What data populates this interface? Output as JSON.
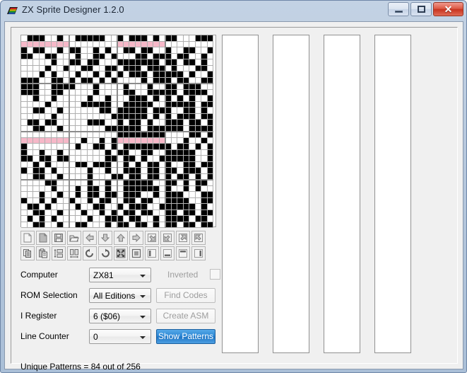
{
  "window": {
    "title": "ZX Sprite Designer 1.2.0",
    "icon": "zx-rainbow-icon",
    "controls": {
      "minimize": "minimize-icon",
      "maximize": "maximize-icon",
      "close": "✕"
    }
  },
  "toolbar": {
    "row1": [
      {
        "name": "new-file",
        "icon": "page-blank-icon"
      },
      {
        "name": "copy-page",
        "icon": "page-filled-icon"
      },
      {
        "name": "save-file",
        "icon": "floppy-disk-icon"
      },
      {
        "name": "open-file",
        "icon": "open-folder-icon"
      },
      {
        "name": "shift-left",
        "icon": "arrow-left-icon"
      },
      {
        "name": "shift-down",
        "icon": "arrow-down-icon"
      },
      {
        "name": "shift-up",
        "icon": "arrow-up-icon"
      },
      {
        "name": "shift-right",
        "icon": "arrow-right-icon"
      },
      {
        "name": "shift-down-right",
        "icon": "arrow-down-right-icon"
      },
      {
        "name": "shift-down-left",
        "icon": "arrow-down-left-icon"
      },
      {
        "name": "shift-up-right",
        "icon": "arrow-up-right-icon"
      },
      {
        "name": "shift-up-left",
        "icon": "arrow-up-left-icon"
      }
    ],
    "row2": [
      {
        "name": "copy",
        "icon": "copy-icon"
      },
      {
        "name": "paste",
        "icon": "clipboard-paste-icon"
      },
      {
        "name": "flip-vertical",
        "icon": "flip-vertical-icon"
      },
      {
        "name": "flip-horizontal",
        "icon": "flip-horizontal-icon"
      },
      {
        "name": "rotate-left",
        "icon": "rotate-ccw-icon"
      },
      {
        "name": "rotate-right",
        "icon": "rotate-cw-icon"
      },
      {
        "name": "resize",
        "icon": "resize-arrows-icon"
      },
      {
        "name": "fill-square",
        "icon": "square-outline-icon"
      },
      {
        "name": "edge-left",
        "icon": "bar-left-icon"
      },
      {
        "name": "edge-bottom",
        "icon": "bar-bottom-icon"
      },
      {
        "name": "edge-top",
        "icon": "bar-top-icon"
      },
      {
        "name": "edge-right",
        "icon": "bar-right-icon"
      }
    ]
  },
  "form": {
    "computer": {
      "label": "Computer",
      "value": "ZX81"
    },
    "rom_selection": {
      "label": "ROM Selection",
      "value": "All Editions"
    },
    "i_register": {
      "label": "I Register",
      "value": "6 ($06)"
    },
    "line_counter": {
      "label": "Line Counter",
      "value": "0"
    },
    "inverted": {
      "label": "Inverted",
      "checked": false
    },
    "find_codes": {
      "label": "Find Codes",
      "enabled": false
    },
    "create_asm": {
      "label": "Create ASM",
      "enabled": false
    },
    "show_patterns": {
      "label": "Show Patterns",
      "enabled": true
    }
  },
  "status": {
    "text": "Unique Patterns =  84 out of 256",
    "unique_patterns": 84,
    "total_patterns": 256
  },
  "colors": {
    "pixel_on": "#000000",
    "pixel_off": "#ffffff",
    "pixel_highlight": "#f6b8c8",
    "grid_line": "#b0b0b0",
    "block_line": "#8c8c8c",
    "accent": "#2b86d4",
    "window_frame": "#b7c8dd"
  },
  "sprite": {
    "cols": 32,
    "rows": 32,
    "cell": 8.5,
    "highlight_rows": [
      1,
      17
    ],
    "highlight_cols": [
      [
        0,
        7
      ],
      [
        16,
        23
      ]
    ],
    "pixels": [
      "01110010011111001011101011000111",
      "00000000000000001111111100000000",
      "10110010110010100110110010011001",
      "11001100010011010001101110110010",
      "00000100110110001111111011011010",
      "00001001001100110111011101000110",
      "00010100010010101011101111101001",
      "11100110101101010000101110110011",
      "11100111100010000100010011011100",
      "11100110000010000110011111011110",
      "00100100000100100011101010101001",
      "00001000001111100111110011111011",
      "00110010000001101111101110011010",
      "00000100000000011111101010111011",
      "01101100000111001011010011101101",
      "00110010000000111111011111101111",
      "00000000000000001111111100001101",
      "01000000001001010111111100010010",
      "10000000010011010111111110110101",
      "10010010000000101100110011111001",
      "11011011000000110110100111111001",
      "00101000011011100101011010011011",
      "10110100000100100111011011011101",
      "00110010000100011011011010110101",
      "00001100000100100111110011010110",
      "00000100010110100111111010010100",
      "00010010010110110111001011100011",
      "10010100100101100110110011110011",
      "01101000010011001011100111111010",
      "00110010001001010110110011011011",
      "01010100000100111011001011110110",
      "00110010011000101101101011011011"
    ]
  }
}
